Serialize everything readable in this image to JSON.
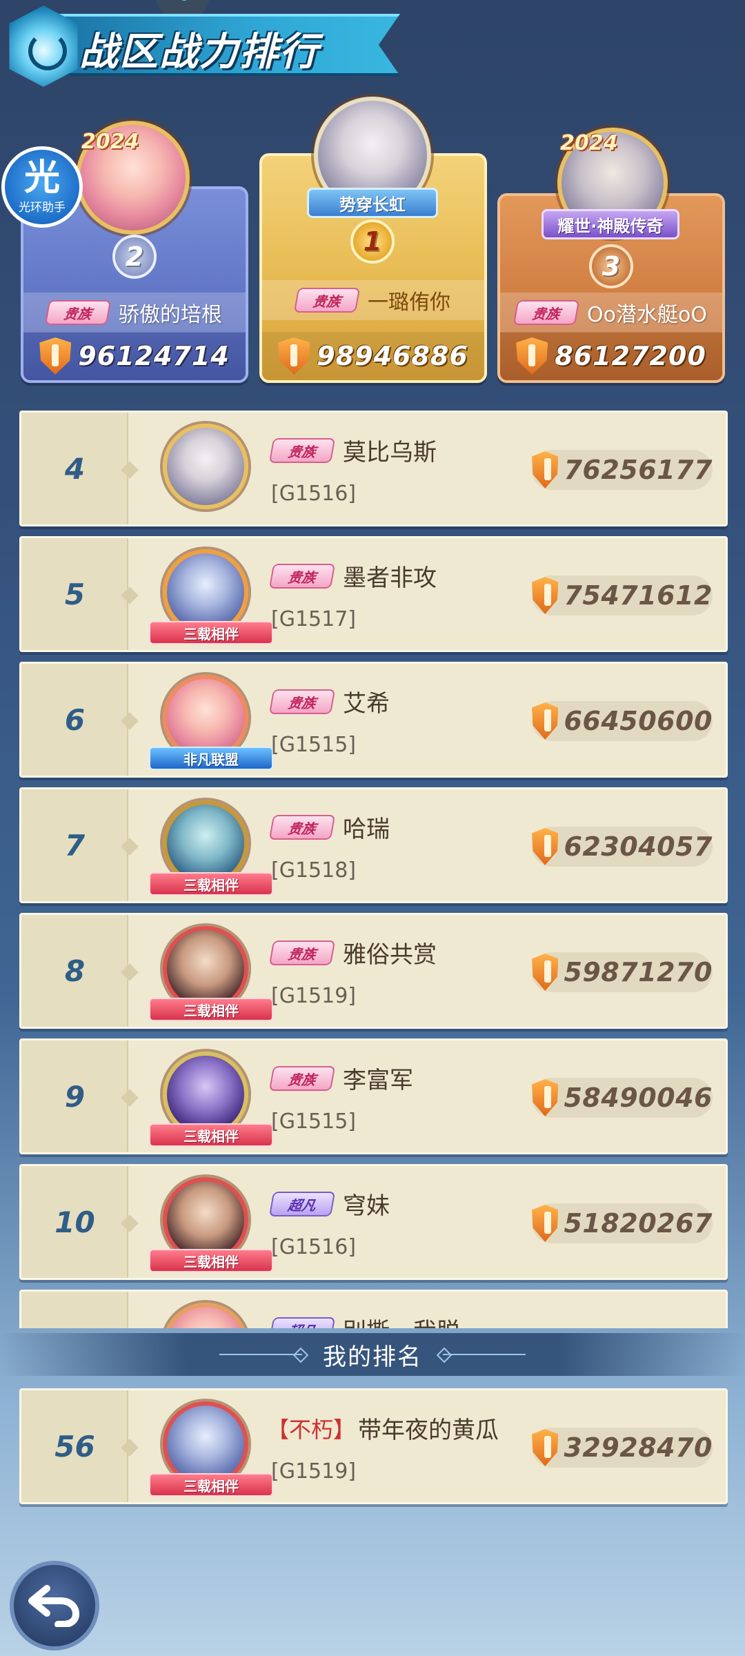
{
  "header": {
    "title": "战区战力排行"
  },
  "badges": {
    "guang_char": "光",
    "guang_sub": "光环助手",
    "year": "2024"
  },
  "podium": [
    {
      "rank": "2",
      "name": "骄傲的培根",
      "power": "96124714",
      "vip": "贵族"
    },
    {
      "rank": "1",
      "name": "一璐侑你",
      "power": "98946886",
      "vip": "贵族",
      "banner": "势穿长虹"
    },
    {
      "rank": "3",
      "name": "Oo潜水艇oO",
      "power": "86127200",
      "vip": "贵族",
      "banner": "耀世·神殿传奇"
    }
  ],
  "ranking": [
    {
      "rank": "4",
      "name": "莫比乌斯",
      "server": "[G1516]",
      "power": "76256177",
      "vip": "贵族"
    },
    {
      "rank": "5",
      "name": "墨者非攻",
      "server": "[G1517]",
      "power": "75471612",
      "vip": "贵族",
      "ribbon": "三载相伴"
    },
    {
      "rank": "6",
      "name": "艾希",
      "server": "[G1515]",
      "power": "66450600",
      "vip": "贵族",
      "ribbon": "非凡联盟"
    },
    {
      "rank": "7",
      "name": "哈瑞",
      "server": "[G1518]",
      "power": "62304057",
      "vip": "贵族",
      "ribbon": "三载相伴"
    },
    {
      "rank": "8",
      "name": "雅俗共赏",
      "server": "[G1519]",
      "power": "59871270",
      "vip": "贵族",
      "ribbon": "三载相伴"
    },
    {
      "rank": "9",
      "name": "李富军",
      "server": "[G1515]",
      "power": "58490046",
      "vip": "贵族",
      "ribbon": "三载相伴"
    },
    {
      "rank": "10",
      "name": "穹妹",
      "server": "[G1516]",
      "power": "51820267",
      "vip": "超凡",
      "ribbon": "三载相伴"
    },
    {
      "rank": "",
      "name": "别撕、我脱",
      "server": "",
      "power": "",
      "vip": "超凡"
    }
  ],
  "my_rank": {
    "header": "我的排名",
    "rank": "56",
    "title_tag": "【不朽】",
    "name": "带年夜的黄瓜",
    "server": "[G1519]",
    "power": "32928470",
    "ribbon": "三载相伴"
  },
  "colors": {
    "rank_text": "#2f5d88",
    "row_bg": "#efe9d2",
    "card_silver": "#5f74c4",
    "card_gold": "#e6b84e",
    "card_bronze": "#cf7c40"
  }
}
